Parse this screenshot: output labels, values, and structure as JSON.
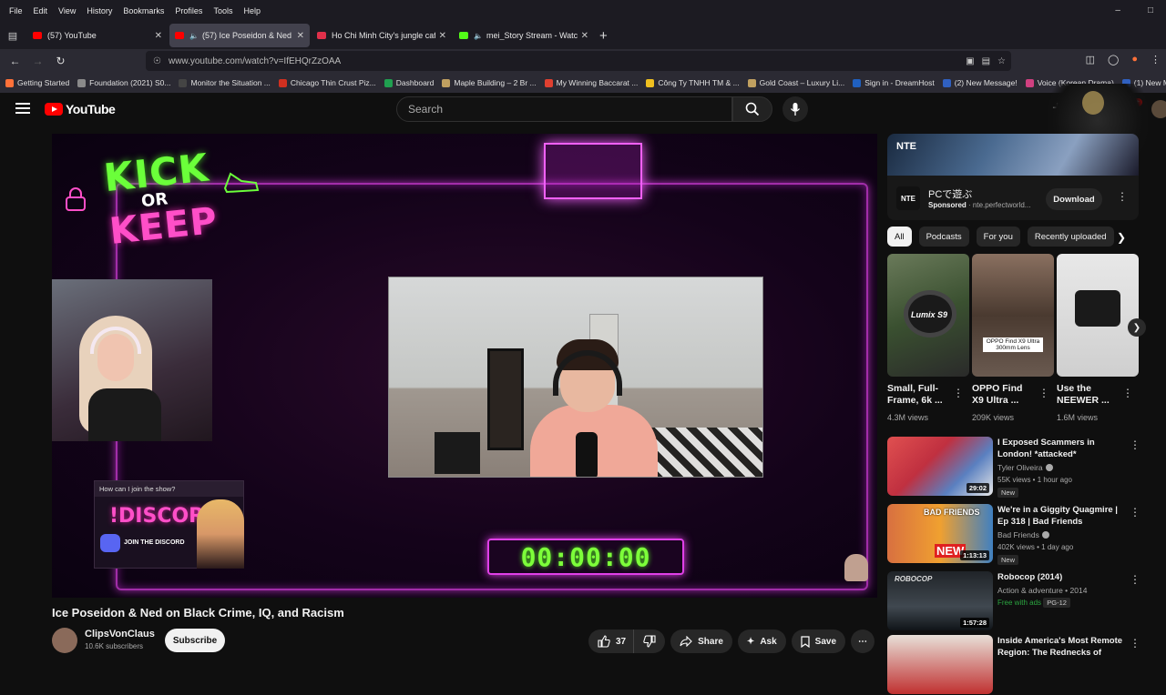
{
  "menubar": {
    "items": [
      "File",
      "Edit",
      "View",
      "History",
      "Bookmarks",
      "Profiles",
      "Tools",
      "Help"
    ]
  },
  "tabs": [
    {
      "title": "(57) YouTube",
      "active": false,
      "color": "#ff0000"
    },
    {
      "title": "(57) Ice Poseidon & Ned on Black Crime, IQ, and Racism",
      "active": true,
      "color": "#ff0000"
    },
    {
      "title": "Ho Chi Minh City's jungle cafe w",
      "active": false,
      "color": "#e0304a"
    },
    {
      "title": "mei_Story Stream - Watch Live",
      "active": false,
      "color": "#53fc18"
    }
  ],
  "url": "www.youtube.com/watch?v=IfEHQrZzOAA",
  "bookmarks": [
    {
      "label": "Getting Started",
      "color": "#ff7139"
    },
    {
      "label": "Foundation (2021) S0...",
      "color": "#8a8a8a"
    },
    {
      "label": "Monitor the Situation ...",
      "color": "#444"
    },
    {
      "label": "Chicago Thin Crust Piz...",
      "color": "#d03020"
    },
    {
      "label": "Dashboard",
      "color": "#20a050"
    },
    {
      "label": "Maple Building – 2 Br ...",
      "color": "#c0a060"
    },
    {
      "label": "My Winning Baccarat ...",
      "color": "#e04030"
    },
    {
      "label": "Công Ty TNHH TM & ...",
      "color": "#f0c020"
    },
    {
      "label": "Gold Coast – Luxury Li...",
      "color": "#c0a060"
    },
    {
      "label": "Sign in - DreamHost",
      "color": "#2060c0"
    },
    {
      "label": "(2) New Message!",
      "color": "#3060c0"
    },
    {
      "label": "Voice (Korean Drama)",
      "color": "#d04080"
    },
    {
      "label": "(1) New Messag",
      "color": "#3060c0"
    }
  ],
  "yt": {
    "logo": "YouTube",
    "search_placeholder": "Search",
    "notif_count": "9+"
  },
  "video": {
    "overlay_kick": "KICK",
    "overlay_or": "OR",
    "overlay_keep": "KEEP",
    "discord_question": "How can I join the show?",
    "discord_title": "!DISCORD",
    "discord_join": "JOIN THE DISCORD",
    "timer": "00:00:00",
    "title": "Ice Poseidon & Ned on Black Crime, IQ, and Racism",
    "channel": "ClipsVonClaus",
    "subscribers": "10.6K subscribers",
    "subscribe": "Subscribe",
    "likes": "37",
    "share": "Share",
    "ask": "Ask",
    "save": "Save"
  },
  "ad": {
    "brand": "NTE",
    "icon_text": "NTE",
    "title": "PCで遊ぶ",
    "sponsored": "Sponsored",
    "domain": "nte.perfectworld...",
    "cta": "Download"
  },
  "chips": [
    "All",
    "Podcasts",
    "For you",
    "Recently uploaded"
  ],
  "shorts": [
    {
      "label": "Lumix S9",
      "title1": "Small, Full-",
      "title2": "Frame, 6k ...",
      "views": "4.3M views"
    },
    {
      "label": "OPPO Find X9 Ultra 300mm Lens",
      "title1": "OPPO Find",
      "title2": "X9 Ultra ...",
      "views": "209K views"
    },
    {
      "label": "",
      "title1": "Use the",
      "title2": "NEEWER ...",
      "views": "1.6M views"
    }
  ],
  "recs": [
    {
      "title": "I Exposed Scammers in London! *attacked*",
      "channel": "Tyler Oliveira",
      "meta": "55K views • 1 hour ago",
      "badge": "New",
      "duration": "29:02"
    },
    {
      "title": "We're in a Giggity Quagmire | Ep 318 | Bad Friends",
      "channel": "Bad Friends",
      "meta": "402K views • 1 day ago",
      "badge": "New",
      "duration": "1:13:13",
      "thumb_text1": "BAD FRIENDS",
      "thumb_text2": "NEW"
    },
    {
      "title": "Robocop (2014)",
      "channel": "Action & adventure • 2014",
      "meta": "Free with ads",
      "meta2": "PG-12",
      "duration": "1:57:28",
      "thumb_text1": "ROBOCOP"
    },
    {
      "title": "Inside America's Most Remote Region: The Rednecks of",
      "channel": "",
      "meta": "",
      "duration": ""
    }
  ]
}
